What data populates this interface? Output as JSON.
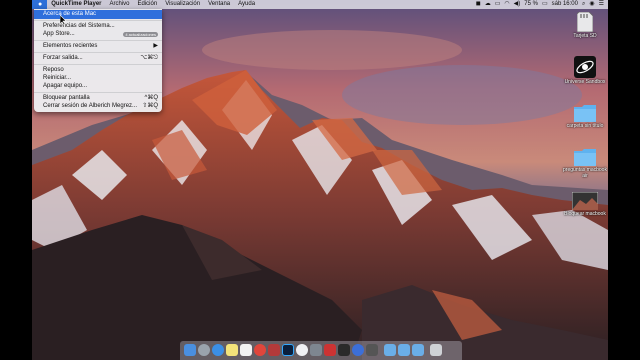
{
  "menubar": {
    "apple_icon": "apple-logo-icon",
    "app_name": "QuickTime Player",
    "items": [
      "Archivo",
      "Edición",
      "Visualización",
      "Ventana",
      "Ayuda"
    ],
    "battery": "75 %",
    "clock": "sáb 16:00",
    "status_icons": [
      "wifi-icon",
      "volume-icon",
      "spotlight-search-icon",
      "siri-icon",
      "notification-center-icon"
    ]
  },
  "apple_menu": {
    "about": "Acerca de esta Mac",
    "system_prefs": "Preferencias del Sistema...",
    "app_store": "App Store...",
    "app_store_badge": "4 actualizaciones",
    "recent": "Elementos recientes",
    "recent_arrow": "▶",
    "force_quit": "Forzar salida...",
    "force_quit_shortcut": "⌥⌘⎋",
    "sleep": "Reposo",
    "restart": "Reiniciar...",
    "shutdown": "Apagar equipo...",
    "lock": "Bloquear pantalla",
    "lock_shortcut": "^⌘Q",
    "logout": "Cerrar sesión de Alberich Megrez...",
    "logout_shortcut": "⇧⌘Q"
  },
  "desktop_icons": [
    {
      "label": "Tarjeta SD",
      "icon": "sd-card-icon"
    },
    {
      "label": "Universe Sandbox",
      "icon": "universe-sandbox-app-icon"
    },
    {
      "label": "carpeta sin título",
      "icon": "folder-icon"
    },
    {
      "label": "preguntas macbook air",
      "icon": "folder-icon"
    },
    {
      "label": "Bloquear macbook",
      "icon": "screenshot-thumbnail-icon"
    }
  ],
  "dock_icons": [
    "finder-icon",
    "launchpad-icon",
    "safari-icon",
    "notes-icon",
    "textedit-icon",
    "chrome-icon",
    "photo-booth-icon",
    "photoshop-icon",
    "itunes-icon",
    "system-preferences-icon",
    "quicktime-icon",
    "trash-icon"
  ],
  "colors": {
    "selection": "#2f6fdc",
    "menu_bg": "#ececee",
    "folder": "#5fb2ef"
  }
}
